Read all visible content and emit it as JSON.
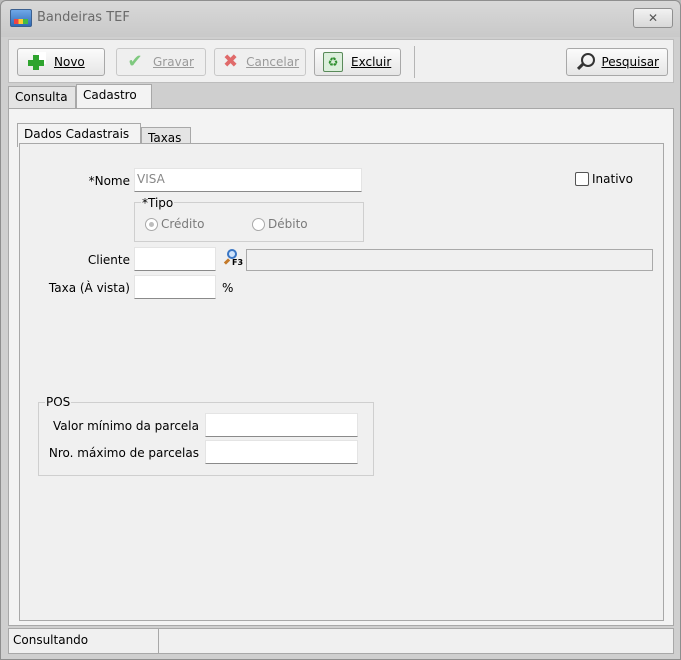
{
  "window": {
    "title": "Bandeiras TEF",
    "close_glyph": "✕"
  },
  "toolbar": {
    "novo": "Novo",
    "gravar": "Gravar",
    "cancelar": "Cancelar",
    "excluir": "Excluir",
    "pesquisar": "Pesquisar"
  },
  "tabs": [
    {
      "label": "Consulta"
    },
    {
      "label": "Cadastro"
    }
  ],
  "subtabs": [
    {
      "label": "Dados Cadastrais"
    },
    {
      "label": "Taxas"
    }
  ],
  "form": {
    "nome_label": "*Nome",
    "nome_value": "VISA",
    "inativo_label": "Inativo",
    "inativo_checked": false,
    "tipo_group": "*Tipo",
    "tipo_options": [
      {
        "label": "Crédito",
        "selected": true
      },
      {
        "label": "Débito",
        "selected": false
      }
    ],
    "cliente_label": "Cliente",
    "cliente_value": "",
    "cliente_name_value": "",
    "lookup_key": "F3",
    "taxa_label": "Taxa (À vista)",
    "taxa_value": "",
    "taxa_unit": "%"
  },
  "pos": {
    "group_title": "POS",
    "valor_minimo_label": "Valor mínimo da parcela",
    "valor_minimo_value": "",
    "nro_maximo_label": "Nro. máximo de parcelas",
    "nro_maximo_value": ""
  },
  "status": {
    "text": "Consultando",
    "secondary": ""
  },
  "icons": {
    "app": "app-icon",
    "novo": "plus-icon",
    "gravar": "check-icon",
    "cancelar": "x-icon",
    "excluir": "recycle-icon",
    "pesquisar": "magnifier-icon",
    "lookup": "search-f3-icon"
  }
}
